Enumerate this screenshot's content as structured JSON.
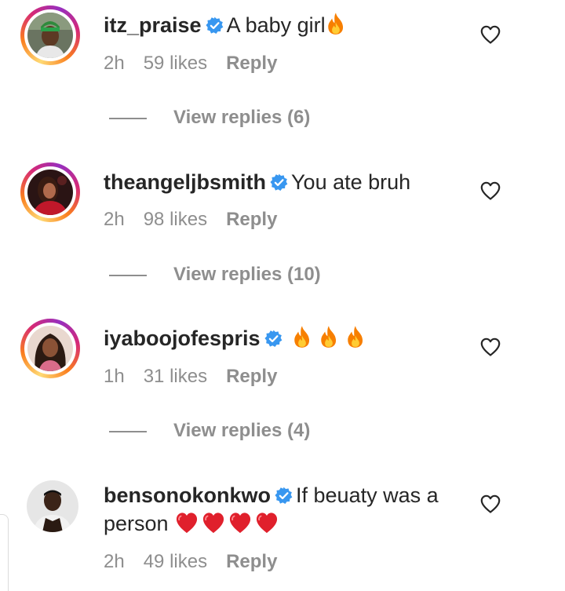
{
  "comments": [
    {
      "username": "itz_praise",
      "text": "A baby girl",
      "emoji": [
        "fire"
      ],
      "time": "2h",
      "likes": "59 likes",
      "reply_label": "Reply",
      "view_replies": "View replies (6)",
      "story_ring": true
    },
    {
      "username": "theangeljbsmith",
      "text": "You ate bruh",
      "emoji": [],
      "time": "2h",
      "likes": "98 likes",
      "reply_label": "Reply",
      "view_replies": "View replies (10)",
      "story_ring": true
    },
    {
      "username": "iyaboojofespris",
      "text": "",
      "emoji": [
        "fire",
        "fire",
        "fire"
      ],
      "time": "1h",
      "likes": "31 likes",
      "reply_label": "Reply",
      "view_replies": "View replies (4)",
      "story_ring": true
    },
    {
      "username": "bensonokonkwo",
      "text": "If beuaty was a person",
      "emoji": [
        "red-heart",
        "red-heart",
        "red-heart",
        "red-heart"
      ],
      "time": "2h",
      "likes": "49 likes",
      "reply_label": "Reply",
      "story_ring": false
    }
  ],
  "colors": {
    "text": "#262626",
    "secondary": "#8e8e8e",
    "verified": "#3897f0",
    "fire": "#f77f00",
    "heart_emoji": "#e0202c"
  },
  "icons": {
    "verified": "verified-badge-icon",
    "like": "heart-outline-icon",
    "fire": "fire-emoji-icon",
    "red_heart": "red-heart-emoji-icon"
  }
}
